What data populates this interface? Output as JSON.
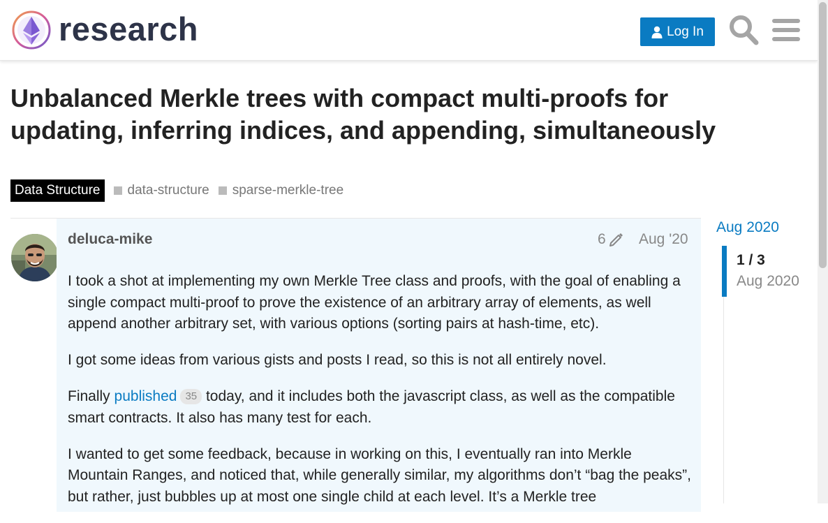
{
  "header": {
    "site_name": "research",
    "login_label": "Log In"
  },
  "topic": {
    "title": "Unbalanced Merkle trees with compact multi-proofs for updating, inferring indices, and appending, simultaneously",
    "category": "Data Structure",
    "tags": [
      "data-structure",
      "sparse-merkle-tree"
    ]
  },
  "post": {
    "author": "deluca-mike",
    "edit_count": "6",
    "date": "Aug '20",
    "paragraphs": [
      "I took a shot at implementing my own Merkle Tree class and proofs, with the goal of enabling a single compact multi-proof to prove the existence of an arbitrary array of elements, as well append another arbitrary set, with various options (sorting pairs at hash-time, etc).",
      "I got some ideas from various gists and posts I read, so this is not all entirely novel."
    ],
    "p3_before": "Finally ",
    "p3_link": "published",
    "p3_link_clicks": "35",
    "p3_after": " today, and it includes both the javascript class, as well as the compatible smart contracts. It also has many test for each.",
    "p4": "I wanted to get some feedback, because in working on this, I eventually ran into Merkle Mountain Ranges, and noticed that, while generally similar, my algorithms don’t “bag the peaks”, but rather, just bubbles up at most one single child at each level. It’s a Merkle tree"
  },
  "timeline": {
    "start": "Aug 2020",
    "position": "1 / 3",
    "current_date": "Aug 2020"
  },
  "colors": {
    "accent": "#0a7bc2",
    "category_badge": "#000000",
    "post_highlight": "#f0f8fd"
  },
  "icons": [
    "discourse-logo-icon",
    "user-icon",
    "search-icon",
    "hamburger-menu-icon",
    "pencil-icon"
  ]
}
